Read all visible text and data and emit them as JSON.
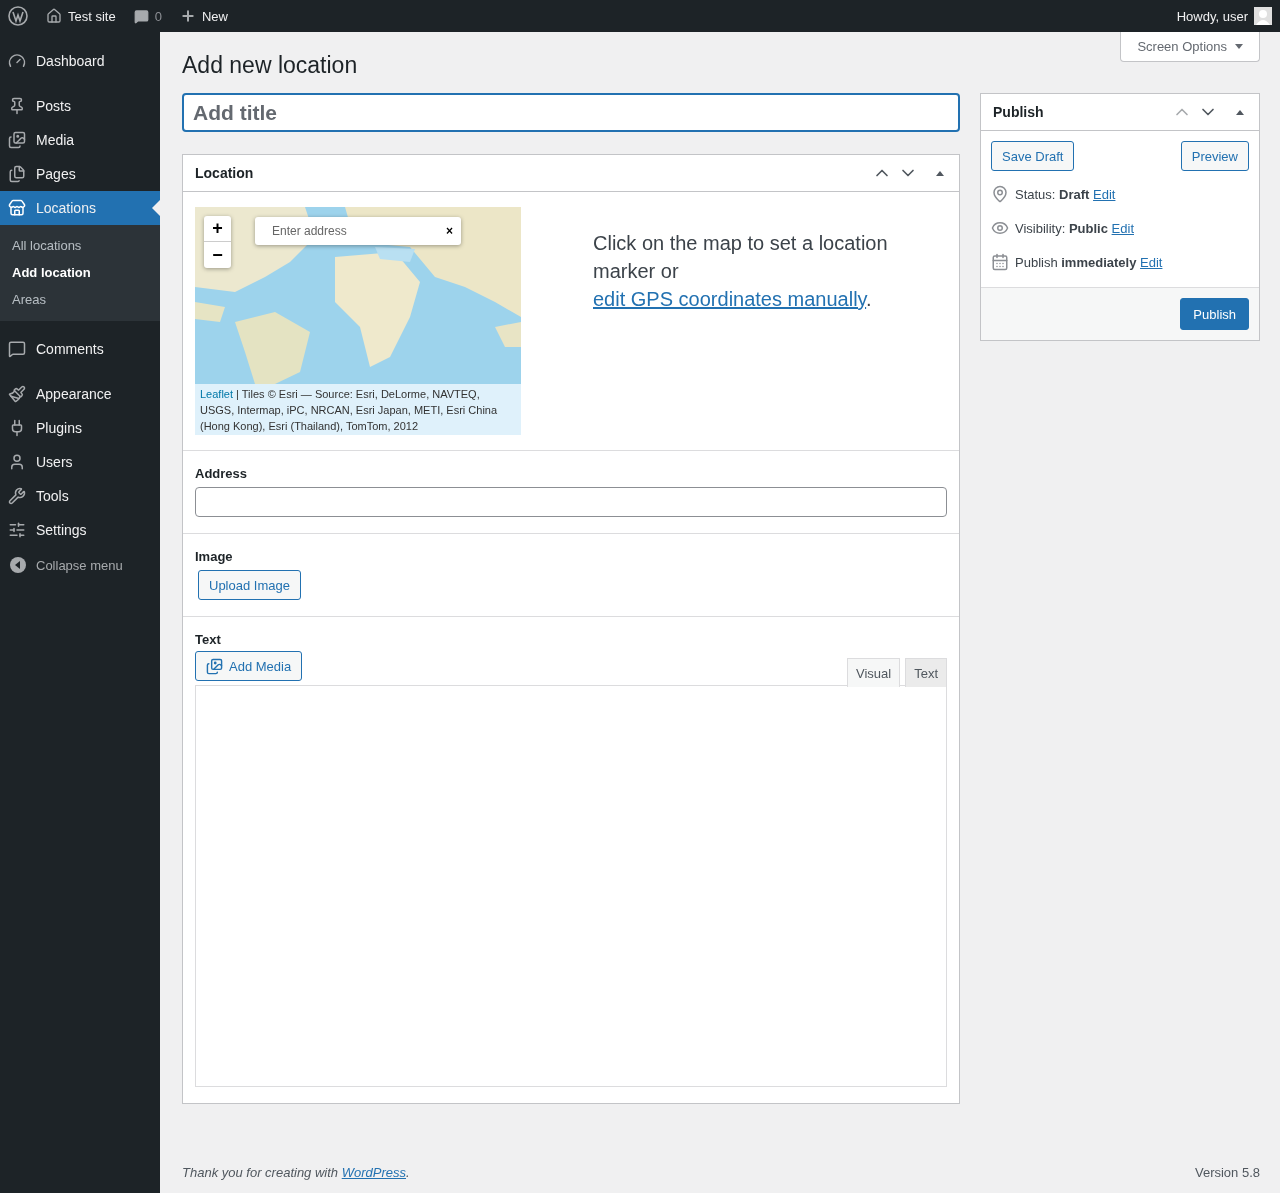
{
  "admin_bar": {
    "site": "Test site",
    "comments": "0",
    "new": "New",
    "greeting": "Howdy, user"
  },
  "sidebar": {
    "items": [
      {
        "label": "Dashboard",
        "selected": false
      },
      {
        "label": "Posts",
        "selected": false
      },
      {
        "label": "Media",
        "selected": false
      },
      {
        "label": "Pages",
        "selected": false
      },
      {
        "label": "Locations",
        "selected": true,
        "children": [
          {
            "label": "All locations",
            "selected": false
          },
          {
            "label": "Add location",
            "selected": true
          },
          {
            "label": "Areas",
            "selected": false
          }
        ]
      },
      {
        "label": "Comments",
        "selected": false
      },
      {
        "label": "Appearance",
        "selected": false
      },
      {
        "label": "Plugins",
        "selected": false
      },
      {
        "label": "Users",
        "selected": false
      },
      {
        "label": "Tools",
        "selected": false
      },
      {
        "label": "Settings",
        "selected": false
      }
    ],
    "collapse": "Collapse menu"
  },
  "screen_options": "Screen Options",
  "page_title": "Add new location",
  "title_field": {
    "placeholder": "Add title"
  },
  "location_box": {
    "title": "Location",
    "map": {
      "zoom_in": "+",
      "zoom_out": "−",
      "search_placeholder": "Enter address",
      "clear": "×",
      "attribution_link": "Leaflet",
      "attribution": " | Tiles © Esri — Source: Esri, DeLorme, NAVTEQ, USGS, Intermap, iPC, NRCAN, Esri Japan, METI, Esri China (Hong Kong), Esri (Thailand), TomTom, 2012"
    },
    "hint": "Click on the map to set a location marker or ",
    "hint_link": "edit GPS coordinates manually",
    "hint_after": ".",
    "address_label": "Address",
    "image_label": "Image",
    "upload_button": "Upload Image",
    "text_label": "Text",
    "add_media": "Add Media",
    "editor_tabs": [
      {
        "label": "Visual",
        "selected": true
      },
      {
        "label": "Text",
        "selected": false
      }
    ]
  },
  "publish": {
    "title": "Publish",
    "save_draft": "Save Draft",
    "preview": "Preview",
    "rows": [
      {
        "kind": "status",
        "text": "Status: **Draft** ",
        "link": "Edit"
      },
      {
        "kind": "visibility",
        "text": "Visibility: **Public** ",
        "link": "Edit"
      },
      {
        "kind": "schedule",
        "text": "Publish **immediately** ",
        "link": "Edit"
      }
    ],
    "button": "Publish"
  },
  "footer": {
    "text": "Thank you for creating with ",
    "link": "WordPress",
    "after": ".",
    "version": "Version 5.8"
  }
}
